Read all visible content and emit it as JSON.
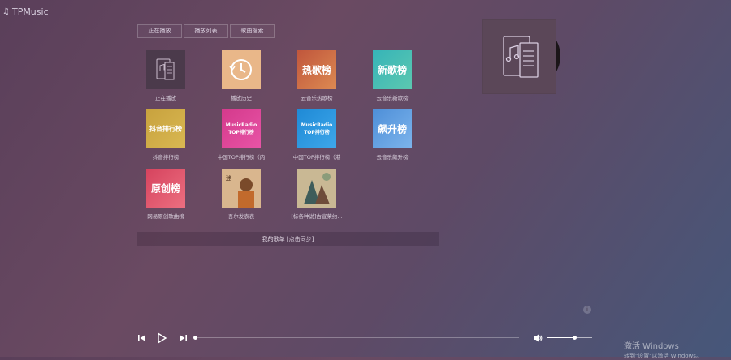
{
  "app": {
    "title": "TPMusic",
    "title_icon": "music-note-icon"
  },
  "tabs": [
    {
      "label": "正在播放"
    },
    {
      "label": "播放列表"
    },
    {
      "label": "歌曲搜索"
    }
  ],
  "playlists": [
    {
      "caption": "正在播放",
      "cover_text": "",
      "cover_colors": [
        "#4b3a4b",
        "#4b3a4b"
      ],
      "icon": "music-list-icon"
    },
    {
      "caption": "播放历史",
      "cover_text": "",
      "cover_colors": [
        "#e9b789",
        "#e9b789"
      ],
      "icon": "history-clock-icon"
    },
    {
      "caption": "云音乐热歌榜",
      "cover_text": "热歌榜",
      "cover_colors": [
        "#c0563c",
        "#dd8a52"
      ],
      "icon": ""
    },
    {
      "caption": "云音乐新歌榜",
      "cover_text": "新歌榜",
      "cover_colors": [
        "#36b4b8",
        "#5cc8b0"
      ],
      "icon": ""
    },
    {
      "caption": "抖音排行榜",
      "cover_text": "抖音排行榜",
      "cover_colors": [
        "#c8a23e",
        "#d9b852"
      ],
      "icon": ""
    },
    {
      "caption": "中国TOP排行榜（内",
      "cover_text": "MusicRadio\nTOP排行榜",
      "cover_colors": [
        "#d43a8c",
        "#e854a6"
      ],
      "icon": ""
    },
    {
      "caption": "中国TOP排行榜（港",
      "cover_text": "MusicRadio\nTOP排行榜",
      "cover_colors": [
        "#1f8ad6",
        "#3ea7ea"
      ],
      "icon": ""
    },
    {
      "caption": "云音乐飙升榜",
      "cover_text": "飙升榜",
      "cover_colors": [
        "#4e8fd8",
        "#7cb4ec"
      ],
      "icon": ""
    },
    {
      "caption": "网易原创歌曲榜",
      "cover_text": "原创榜",
      "cover_colors": [
        "#d6435e",
        "#ec6f80"
      ],
      "icon": ""
    },
    {
      "caption": "吾尔发表表",
      "cover_text": "",
      "cover_colors": [
        "#b88a6a",
        "#7a4a34"
      ],
      "icon": "photo-portrait"
    },
    {
      "caption": "[标各种说]古宣荣约...",
      "cover_text": "",
      "cover_colors": [
        "#c7b79a",
        "#7e8f7c"
      ],
      "icon": "painting-art"
    }
  ],
  "footer": {
    "label": "我的歌单 [点击同步]"
  },
  "player": {
    "progress": 0.0,
    "volume": 0.6
  },
  "watermark": {
    "line1": "激活 Windows",
    "line2": "转到\"设置\"以激活 Windows。"
  }
}
